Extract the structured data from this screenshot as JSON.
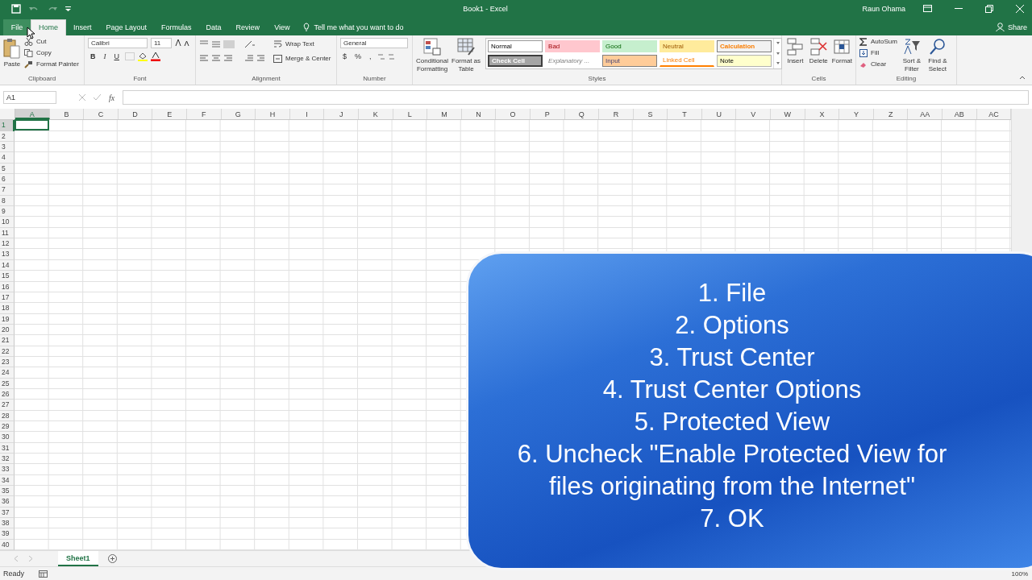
{
  "title_bar": {
    "title": "Book1 - Excel",
    "user": "Raun Ohama"
  },
  "tabs": [
    {
      "label": "File",
      "selected": false
    },
    {
      "label": "Home",
      "selected": true
    },
    {
      "label": "Insert",
      "selected": false
    },
    {
      "label": "Page Layout",
      "selected": false
    },
    {
      "label": "Formulas",
      "selected": false
    },
    {
      "label": "Data",
      "selected": false
    },
    {
      "label": "Review",
      "selected": false
    },
    {
      "label": "View",
      "selected": false
    }
  ],
  "tell_me": "Tell me what you want to do",
  "share": "Share",
  "clipboard": {
    "paste": "Paste",
    "cut": "Cut",
    "copy": "Copy",
    "format_painter": "Format Painter",
    "label": "Clipboard"
  },
  "font": {
    "name": "Calibri",
    "size": "11",
    "bold": "B",
    "italic": "I",
    "underline": "U",
    "label": "Font"
  },
  "alignment": {
    "wrap": "Wrap Text",
    "merge": "Merge & Center",
    "label": "Alignment"
  },
  "number": {
    "format": "General",
    "currency": "$",
    "percent": "%",
    "comma": ",",
    "label": "Number"
  },
  "styles": {
    "conditional": [
      "Conditional",
      "Formatting"
    ],
    "table": [
      "Format as",
      "Table"
    ],
    "label": "Styles",
    "cells": [
      {
        "label": "Normal",
        "kind": "normal"
      },
      {
        "label": "Bad",
        "kind": "bad"
      },
      {
        "label": "Good",
        "kind": "good"
      },
      {
        "label": "Neutral",
        "kind": "neutral"
      },
      {
        "label": "Calculation",
        "kind": "calculation"
      },
      {
        "label": "Check Cell",
        "kind": "check"
      },
      {
        "label": "Explanatory ...",
        "kind": "explanatory"
      },
      {
        "label": "Input",
        "kind": "input"
      },
      {
        "label": "Linked Cell",
        "kind": "linked"
      },
      {
        "label": "Note",
        "kind": "note"
      }
    ]
  },
  "cells": {
    "insert": "Insert",
    "delete": "Delete",
    "format": "Format",
    "label": "Cells"
  },
  "editing": {
    "autosum": "AutoSum",
    "fill": "Fill",
    "clear": "Clear",
    "sort": [
      "Sort &",
      "Filter"
    ],
    "find": [
      "Find &",
      "Select"
    ],
    "label": "Editing"
  },
  "formula_bar": {
    "name_box": "A1",
    "fx": "fx"
  },
  "sheet": {
    "columns": [
      {
        "label": "A",
        "selected": true
      },
      {
        "label": "B",
        "selected": false
      },
      {
        "label": "C",
        "selected": false
      },
      {
        "label": "D",
        "selected": false
      },
      {
        "label": "E",
        "selected": false
      },
      {
        "label": "F",
        "selected": false
      },
      {
        "label": "G",
        "selected": false
      },
      {
        "label": "H",
        "selected": false
      },
      {
        "label": "I",
        "selected": false
      },
      {
        "label": "J",
        "selected": false
      },
      {
        "label": "K",
        "selected": false
      },
      {
        "label": "L",
        "selected": false
      },
      {
        "label": "M",
        "selected": false
      },
      {
        "label": "N",
        "selected": false
      },
      {
        "label": "O",
        "selected": false
      },
      {
        "label": "P",
        "selected": false
      },
      {
        "label": "Q",
        "selected": false
      },
      {
        "label": "R",
        "selected": false
      },
      {
        "label": "S",
        "selected": false
      },
      {
        "label": "T",
        "selected": false
      },
      {
        "label": "U",
        "selected": false
      },
      {
        "label": "V",
        "selected": false
      },
      {
        "label": "W",
        "selected": false
      },
      {
        "label": "X",
        "selected": false
      },
      {
        "label": "Y",
        "selected": false
      },
      {
        "label": "Z",
        "selected": false
      },
      {
        "label": "AA",
        "selected": false
      },
      {
        "label": "AB",
        "selected": false
      },
      {
        "label": "AC",
        "selected": false
      }
    ],
    "rows": [
      {
        "label": "1",
        "selected": true
      },
      {
        "label": "2",
        "selected": false
      },
      {
        "label": "3",
        "selected": false
      },
      {
        "label": "4",
        "selected": false
      },
      {
        "label": "5",
        "selected": false
      },
      {
        "label": "6",
        "selected": false
      },
      {
        "label": "7",
        "selected": false
      },
      {
        "label": "8",
        "selected": false
      },
      {
        "label": "9",
        "selected": false
      },
      {
        "label": "10",
        "selected": false
      },
      {
        "label": "11",
        "selected": false
      },
      {
        "label": "12",
        "selected": false
      },
      {
        "label": "13",
        "selected": false
      },
      {
        "label": "14",
        "selected": false
      },
      {
        "label": "15",
        "selected": false
      },
      {
        "label": "16",
        "selected": false
      },
      {
        "label": "17",
        "selected": false
      },
      {
        "label": "18",
        "selected": false
      },
      {
        "label": "19",
        "selected": false
      },
      {
        "label": "20",
        "selected": false
      },
      {
        "label": "21",
        "selected": false
      },
      {
        "label": "22",
        "selected": false
      },
      {
        "label": "23",
        "selected": false
      },
      {
        "label": "24",
        "selected": false
      },
      {
        "label": "25",
        "selected": false
      },
      {
        "label": "26",
        "selected": false
      },
      {
        "label": "27",
        "selected": false
      },
      {
        "label": "28",
        "selected": false
      },
      {
        "label": "29",
        "selected": false
      },
      {
        "label": "30",
        "selected": false
      },
      {
        "label": "31",
        "selected": false
      },
      {
        "label": "32",
        "selected": false
      },
      {
        "label": "33",
        "selected": false
      },
      {
        "label": "34",
        "selected": false
      },
      {
        "label": "35",
        "selected": false
      },
      {
        "label": "36",
        "selected": false
      },
      {
        "label": "37",
        "selected": false
      },
      {
        "label": "38",
        "selected": false
      },
      {
        "label": "39",
        "selected": false
      },
      {
        "label": "40",
        "selected": false
      }
    ]
  },
  "sheet_tabs": [
    {
      "label": "Sheet1",
      "selected": true
    }
  ],
  "status_bar": {
    "mode": "Ready",
    "zoom": "100%"
  },
  "overlay": {
    "lines": [
      "1. File",
      "2. Options",
      "3. Trust Center",
      "4. Trust Center Options",
      "5. Protected View",
      "6. Uncheck \"Enable Protected View for",
      "files originating from the Internet\"",
      "7. OK"
    ]
  }
}
